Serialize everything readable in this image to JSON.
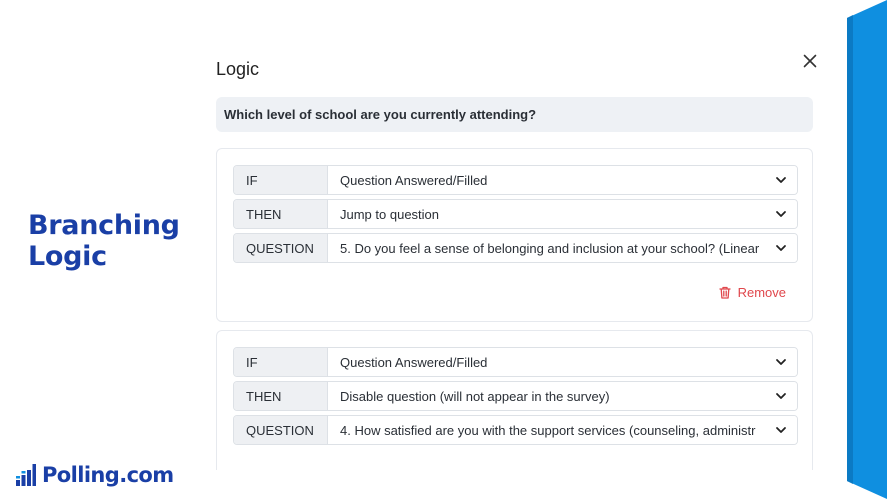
{
  "side_title": {
    "line1": "Branching",
    "line2": "Logic"
  },
  "brand": {
    "name": "Polling.com"
  },
  "modal": {
    "title": "Logic",
    "question": "Which level of school are you currently attending?"
  },
  "rules": [
    {
      "if_label": "IF",
      "if_value": "Question Answered/Filled",
      "then_label": "THEN",
      "then_value": "Jump to question",
      "question_label": "QUESTION",
      "question_value": "5. Do you feel a sense of belonging and inclusion at your school? (Linear",
      "remove_label": "Remove"
    },
    {
      "if_label": "IF",
      "if_value": "Question Answered/Filled",
      "then_label": "THEN",
      "then_value": "Disable question (will not appear in the survey)",
      "question_label": "QUESTION",
      "question_value": "4. How satisfied are you with the support services (counseling, administr"
    }
  ],
  "icons": {
    "close": "close-icon",
    "dropdown": "chevron-down-icon",
    "remove": "trash-icon",
    "brand": "bar-chart-logo-icon"
  },
  "colors": {
    "brand_blue": "#1a3fa6",
    "ribbon_blue": "#0f8fe0",
    "danger_red": "#e0474c",
    "question_bar": "#eef1f5"
  }
}
